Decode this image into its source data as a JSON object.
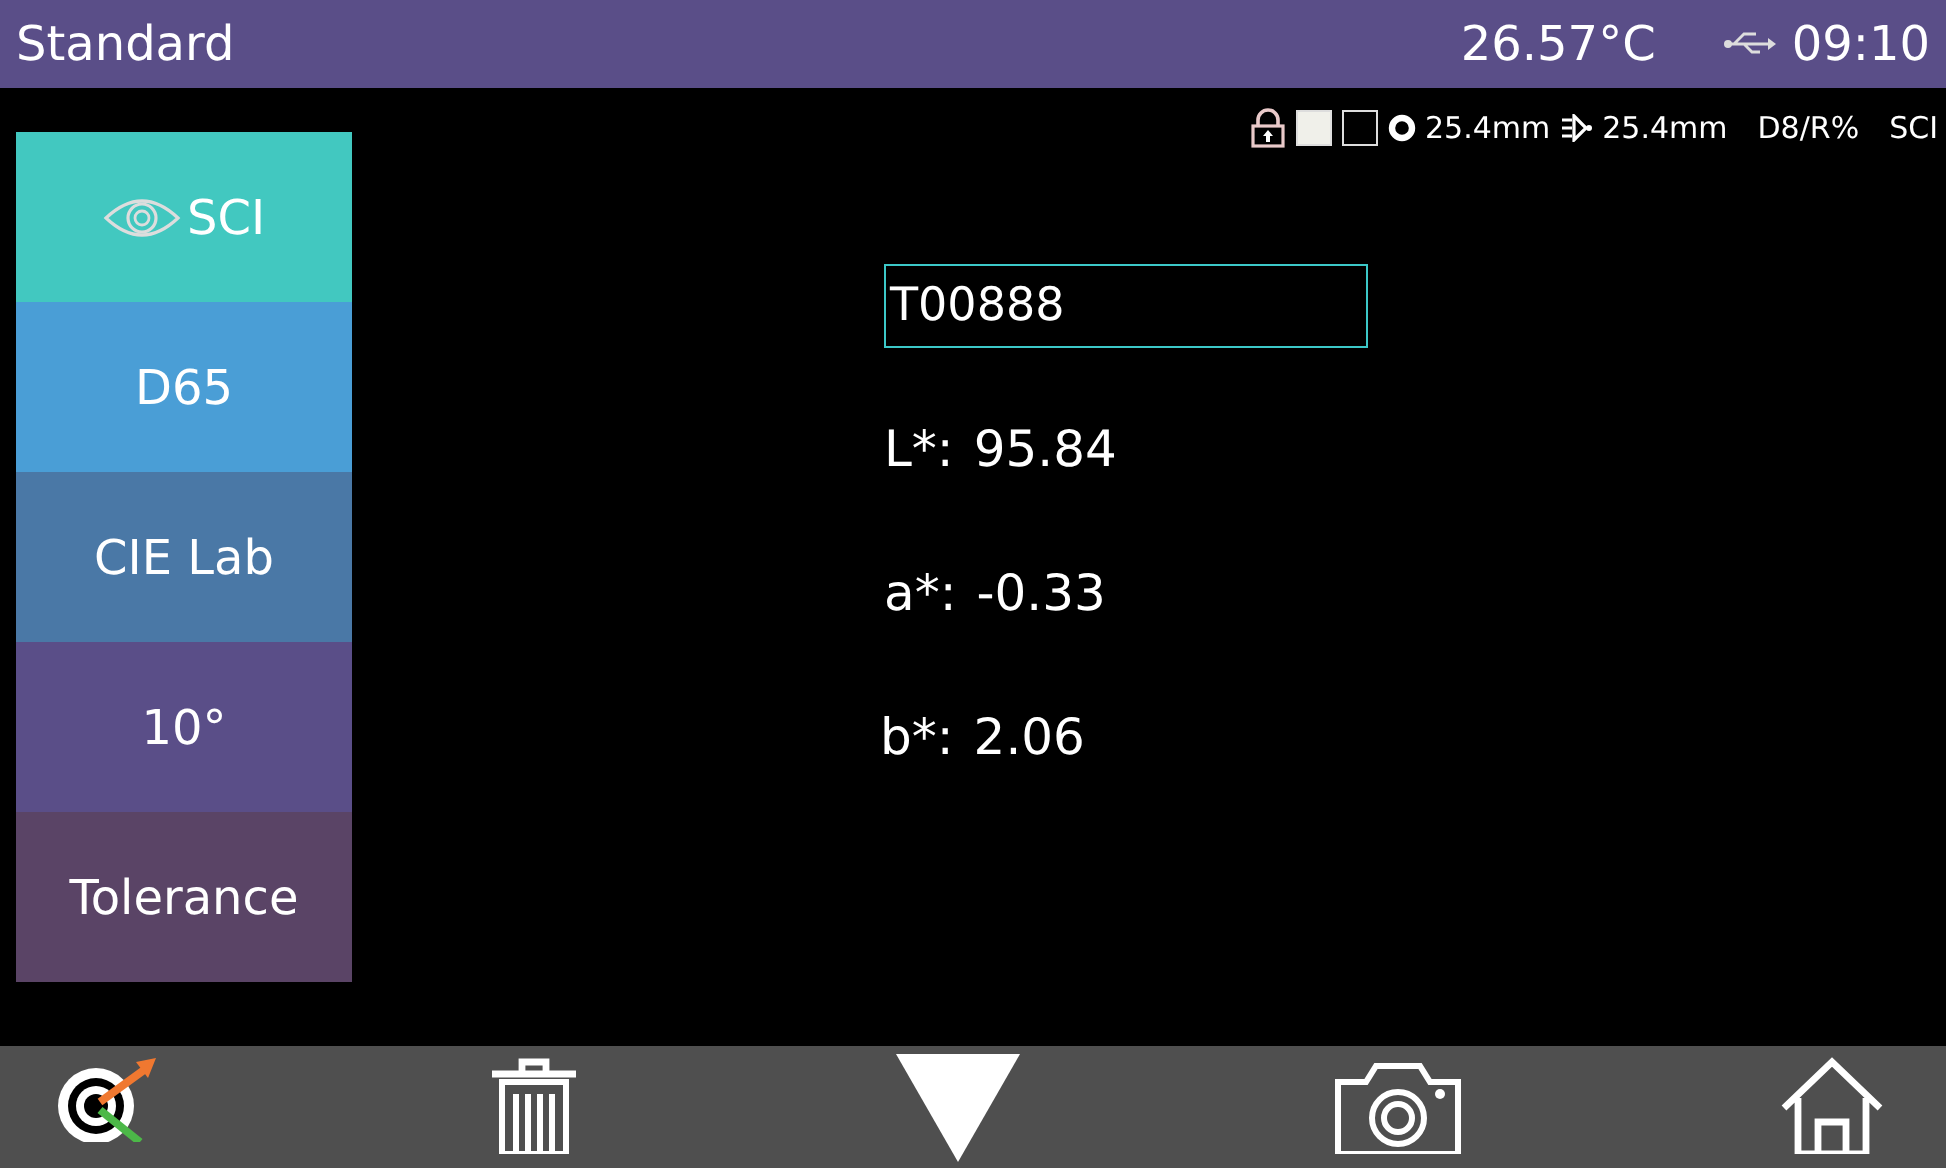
{
  "title_bar": {
    "title": "Standard",
    "temperature": "26.57°C",
    "time": "09:10"
  },
  "status_row": {
    "white_tile_filled": true,
    "black_tile_filled": false,
    "aperture": "25.4mm",
    "lens": "25.4mm",
    "geometry": "D8/R%",
    "mode": "SCI"
  },
  "sidebar": {
    "items": [
      {
        "label": "SCI",
        "kind": "eye",
        "color": "#42c8c0"
      },
      {
        "label": "D65",
        "kind": "text",
        "color": "#4a9ed6"
      },
      {
        "label": "CIE Lab",
        "kind": "text",
        "color": "#4a78a6"
      },
      {
        "label": "10°",
        "kind": "text",
        "color": "#5a4e88"
      },
      {
        "label": "Tolerance",
        "kind": "text",
        "color": "#5a4466"
      }
    ]
  },
  "sample_name": "T00888",
  "readings": [
    {
      "label": "L*:",
      "value": "95.84"
    },
    {
      "label": "a*:",
      "value": "-0.33"
    },
    {
      "label": "b*:",
      "value": "2.06"
    }
  ]
}
